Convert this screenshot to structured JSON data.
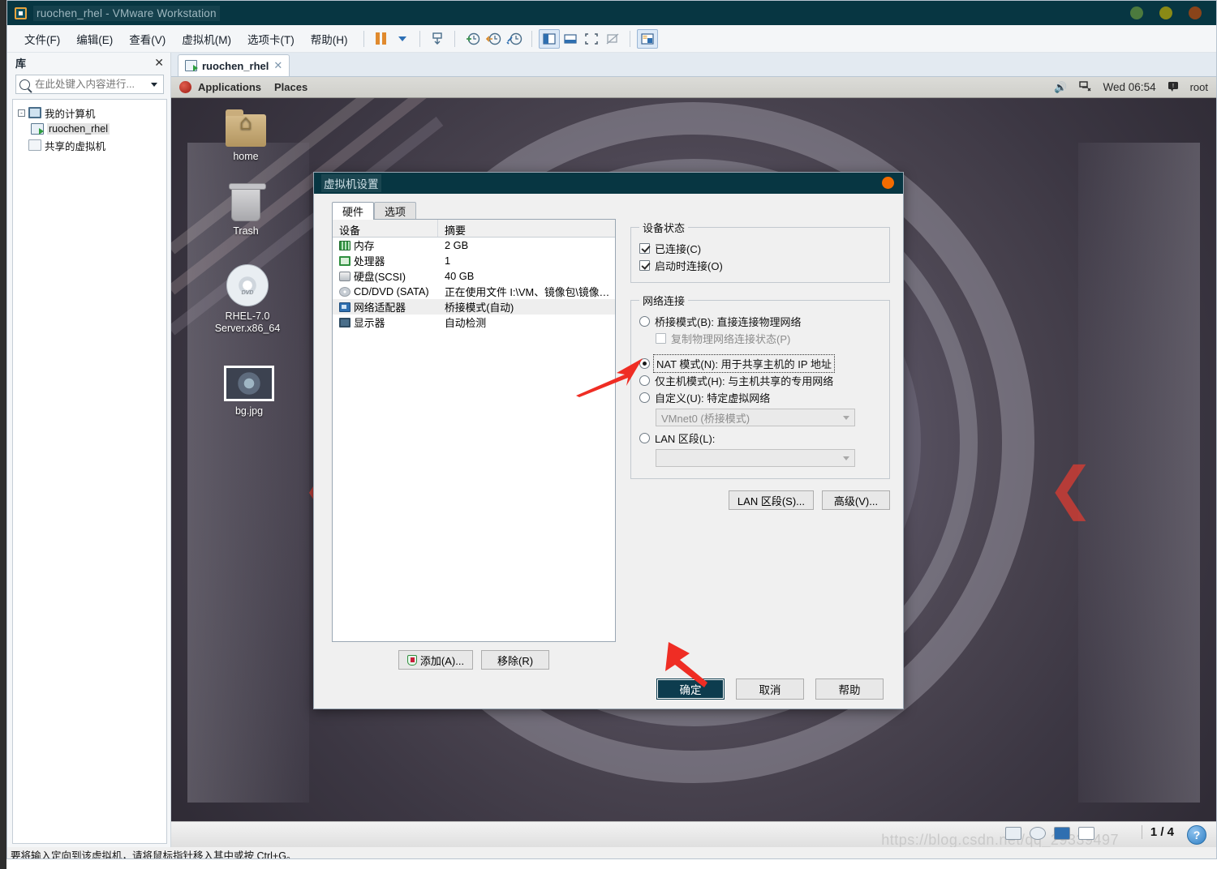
{
  "window": {
    "title": "ruochen_rhel - VMware Workstation",
    "app_icon": "vmware-logo-icon",
    "controls": [
      "minimize-button",
      "maximize-button",
      "close-button"
    ]
  },
  "menubar": {
    "items": [
      {
        "label": "文件(F)"
      },
      {
        "label": "编辑(E)"
      },
      {
        "label": "查看(V)"
      },
      {
        "label": "虚拟机(M)"
      },
      {
        "label": "选项卡(T)"
      },
      {
        "label": "帮助(H)"
      }
    ],
    "toolbar_icons": [
      "pause-icon",
      "dropdown-caret-icon",
      "send-to-vm-icon",
      "snapshot-take-icon",
      "snapshot-revert-icon",
      "snapshot-manager-icon",
      "show-library-icon",
      "show-console-view-icon",
      "fullscreen-icon",
      "unity-mode-icon",
      "show-thumbnail-bar-icon"
    ]
  },
  "sidebar": {
    "title": "库",
    "close_icon": "close-icon",
    "search": {
      "placeholder": "在此处键入内容进行...",
      "value": "",
      "icon": "search-icon",
      "dropdown_icon": "chevron-down-icon"
    },
    "tree": [
      {
        "label": "我的计算机",
        "icon": "monitor-icon",
        "expander": "-",
        "selected": false
      },
      {
        "label": "ruochen_rhel",
        "icon": "vm-running-icon",
        "expander": "",
        "selected": true
      },
      {
        "label": "共享的虚拟机",
        "icon": "shared-vm-icon",
        "expander": "",
        "selected": false
      }
    ]
  },
  "vmtab": {
    "label": "ruochen_rhel",
    "icon": "vm-running-icon",
    "close_icon": "close-icon"
  },
  "guest": {
    "topbar": {
      "logo": "redhat-logo-icon",
      "applications": "Applications",
      "places": "Places",
      "volume_icon": "volume-icon",
      "network_icon": "network-disconnected-icon",
      "clock": "Wed 06:54",
      "user_icon": "user-icon",
      "user": "root"
    },
    "desktop_icons": [
      {
        "label": "home",
        "icon": "home-folder-icon"
      },
      {
        "label": "Trash",
        "icon": "trash-icon"
      },
      {
        "label": "RHEL-7.0 Server.x86_64",
        "icon": "dvd-disc-icon"
      },
      {
        "label": "bg.jpg",
        "icon": "image-thumbnail-icon"
      }
    ],
    "statusbar": {
      "watermark": "https://blog.csdn.net/qq_29339497",
      "page_count": "1 / 4",
      "help_icon": "help-icon"
    }
  },
  "dialog": {
    "title": "虚拟机设置",
    "close_icon": "close-orb-icon",
    "tabs": [
      {
        "label": "硬件",
        "active": true
      },
      {
        "label": "选项",
        "active": false
      }
    ],
    "device_table": {
      "headers": [
        "设备",
        "摘要"
      ],
      "rows": [
        {
          "device": "内存",
          "summary": "2 GB",
          "icon": "memory-icon",
          "selected": false
        },
        {
          "device": "处理器",
          "summary": "1",
          "icon": "cpu-icon",
          "selected": false
        },
        {
          "device": "硬盘(SCSI)",
          "summary": "40 GB",
          "icon": "harddisk-icon",
          "selected": false
        },
        {
          "device": "CD/DVD (SATA)",
          "summary": "正在使用文件 I:\\VM、镜像包\\镜像包...",
          "icon": "cd-dvd-icon",
          "selected": false
        },
        {
          "device": "网络适配器",
          "summary": "桥接模式(自动)",
          "icon": "network-adapter-icon",
          "selected": true
        },
        {
          "device": "显示器",
          "summary": "自动检测",
          "icon": "display-icon",
          "selected": false
        }
      ]
    },
    "device_buttons": [
      {
        "label": "添加(A)...",
        "icon": "shield-add-icon"
      },
      {
        "label": "移除(R)",
        "icon": ""
      }
    ],
    "device_status": {
      "legend": "设备状态",
      "options": [
        {
          "label": "已连接(C)",
          "checked": true
        },
        {
          "label": "启动时连接(O)",
          "checked": true
        }
      ]
    },
    "network_connection": {
      "legend": "网络连接",
      "options": [
        {
          "label": "桥接模式(B): 直接连接物理网络",
          "selected": false,
          "focused": false
        },
        {
          "label": "NAT 模式(N): 用于共享主机的 IP 地址",
          "selected": true,
          "focused": true
        },
        {
          "label": "仅主机模式(H): 与主机共享的专用网络",
          "selected": false,
          "focused": false
        },
        {
          "label": "自定义(U): 特定虚拟网络",
          "selected": false,
          "focused": false
        },
        {
          "label": "LAN 区段(L):",
          "selected": false,
          "focused": false
        }
      ],
      "replicate_checkbox": {
        "label": "复制物理网络连接状态(P)",
        "checked": false,
        "disabled": true
      },
      "custom_select": {
        "value": "VMnet0 (桥接模式)",
        "disabled": true,
        "icon": "chevron-down-icon"
      },
      "lan_select": {
        "value": "",
        "disabled": true,
        "icon": "chevron-down-icon"
      }
    },
    "side_buttons": [
      {
        "label": "LAN 区段(S)..."
      },
      {
        "label": "高级(V)..."
      }
    ],
    "footer_buttons": [
      {
        "label": "确定",
        "primary": true
      },
      {
        "label": "取消",
        "primary": false
      },
      {
        "label": "帮助",
        "primary": false
      }
    ]
  },
  "statusbar": {
    "text": "要将输入定向到该虚拟机，请将鼠标指针移入其中或按 Ctrl+G。"
  },
  "annotations": {
    "arrow_color": "#ef2d24",
    "arrows": [
      "arrow-pointing-nat-mode",
      "arrow-pointing-ok-button"
    ]
  }
}
